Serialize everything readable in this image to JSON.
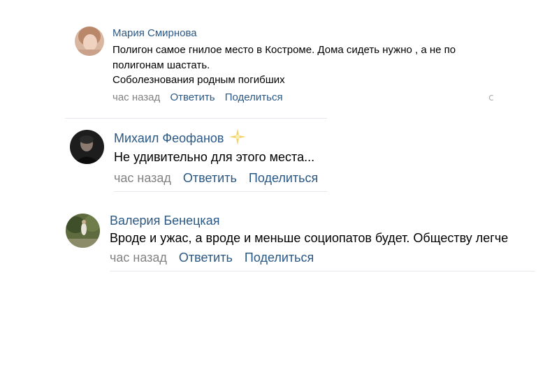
{
  "comments": [
    {
      "author": "Мария Смирнова",
      "lines": [
        "Полигон самое гнилое место в Костроме. Дома сидеть нужно , а не по",
        "полигонам шастать.",
        "Соболезнования родным погибших"
      ],
      "time": "час назад",
      "reply_label": "Ответить",
      "share_label": "Поделиться",
      "more_glyph": "ⅽ"
    },
    {
      "author": "Михаил Феофанов",
      "lines": [
        "Не удивительно для этого места..."
      ],
      "time": "час назад",
      "reply_label": "Ответить",
      "share_label": "Поделиться",
      "badge_color": "#f2d266"
    },
    {
      "author": "Валерия Бенецкая",
      "lines": [
        "Вроде и ужас, а вроде и меньше социопатов будет. Обществу легче"
      ],
      "time": "час назад",
      "reply_label": "Ответить",
      "share_label": "Поделиться"
    }
  ],
  "colors": {
    "link": "#2a5885",
    "meta": "#828282",
    "divider": "#e5e8ec"
  }
}
